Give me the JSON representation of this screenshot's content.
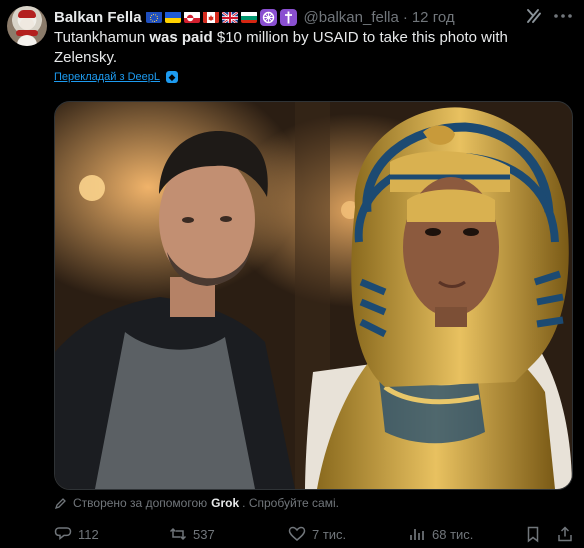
{
  "user": {
    "name": "Balkan Fella",
    "handle": "@balkan_fella",
    "separator": "·",
    "time": "12 год"
  },
  "tweet": {
    "text_before": "Tutankhamun ",
    "text_bold": "was paid",
    "text_after": " $10 million by USAID to take this photo with Zelensky."
  },
  "translate": {
    "label": "Перекладай з DeepL"
  },
  "caption": {
    "prefix": "Створено за допомогою",
    "brand": "Grok",
    "suffix": ". Спробуйте самі."
  },
  "actions": {
    "replies": "112",
    "reposts": "537",
    "likes": "7 тис.",
    "views": "68 тис."
  },
  "icons": {
    "flags": [
      "eu-flag-icon",
      "ukraine-flag-icon",
      "greenland-flag-icon",
      "canada-flag-icon",
      "uk-flag-icon",
      "bulgaria-flag-icon"
    ],
    "badges": [
      "wheel-icon",
      "cross-icon"
    ],
    "top_right": [
      "grok-icon",
      "more-icon"
    ],
    "actions": [
      "reply-icon",
      "repost-icon",
      "like-icon",
      "views-icon",
      "bookmark-icon",
      "share-icon"
    ]
  },
  "colors": {
    "background": "#000000",
    "text": "#e7e9ea",
    "muted": "#71767b",
    "link": "#1d9bf0"
  }
}
